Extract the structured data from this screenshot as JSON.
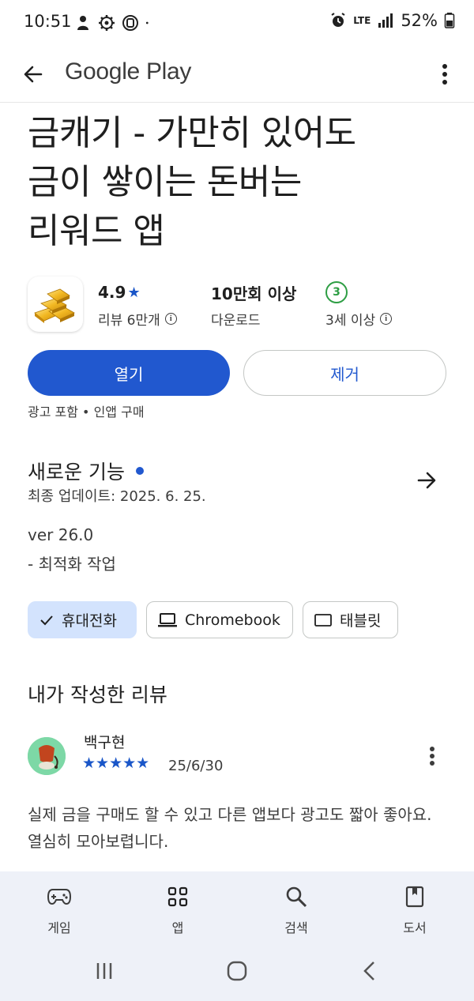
{
  "status_bar": {
    "time": "10:51",
    "network": "LTE",
    "battery": "52%",
    "left_icons": [
      "person-icon",
      "settings-cog-icon",
      "app-d-icon",
      "dot-icon"
    ],
    "right_icons": [
      "alarm-icon",
      "lte-icon",
      "signal-icon",
      "battery-icon"
    ]
  },
  "app_bar": {
    "title": "Google Play",
    "back_icon": "arrow-back-icon",
    "more_icon": "more-vert-icon"
  },
  "app": {
    "title_lines": [
      "금캐기 - 가만히 있어도",
      "금이 쌓이는 돈버는",
      "리워드 앱"
    ],
    "icon": "gold-bars-icon",
    "rating": "4.9",
    "rating_star": "★",
    "reviews_label": "리뷰 6만개",
    "downloads": "10만회 이상",
    "downloads_label": "다운로드",
    "age_rating": "3",
    "age_label": "3세 이상",
    "open_button": "열기",
    "remove_button": "제거",
    "ads_note": "광고 포함 • 인앱 구매"
  },
  "whats_new": {
    "title": "새로운 기능",
    "last_updated": "최종 업데이트: 2025. 6. 25.",
    "notes": [
      "ver 26.0",
      "- 최적화 작업"
    ]
  },
  "device_chips": [
    {
      "label": "휴대전화",
      "icon": "check-icon",
      "selected": true
    },
    {
      "label": "Chromebook",
      "icon": "laptop-icon",
      "selected": false
    },
    {
      "label": "태블릿",
      "icon": "tablet-icon",
      "selected": false
    }
  ],
  "my_review": {
    "section_title": "내가 작성한 리뷰",
    "reviewer": "백구현",
    "stars": "★★★★★",
    "rating": 5,
    "date": "25/6/30",
    "text": "실제 금을 구매도 할 수 있고 다른 앱보다 광고도 짧아 좋아요. 열심히 모아보렵니다."
  },
  "bottom_nav": [
    {
      "label": "게임",
      "icon": "gamepad-icon"
    },
    {
      "label": "앱",
      "icon": "apps-grid-icon"
    },
    {
      "label": "검색",
      "icon": "search-icon"
    },
    {
      "label": "도서",
      "icon": "book-icon"
    }
  ],
  "colors": {
    "accent": "#2158cf",
    "star": "#1a56c8",
    "age_badge": "#2e9e44",
    "chip_selected": "#d3e3fd",
    "nav_bg": "#eef1f8"
  }
}
